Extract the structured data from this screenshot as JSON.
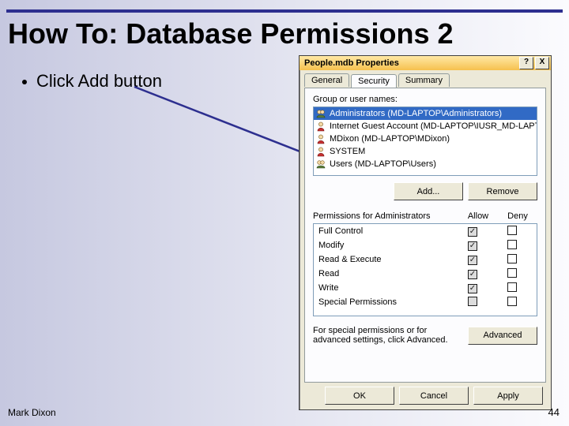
{
  "slide": {
    "title": "How To: Database Permissions 2",
    "bullet": "Click Add button",
    "footer_author": "Mark Dixon",
    "footer_page": "44"
  },
  "dialog": {
    "title": "People.mdb Properties",
    "help_btn": "?",
    "close_btn": "X",
    "tabs": {
      "general": "General",
      "security": "Security",
      "summary": "Summary",
      "active": 1
    },
    "group_label": "Group or user names:",
    "users": [
      {
        "name": "Administrators (MD-LAPTOP\\Administrators)",
        "type": "group"
      },
      {
        "name": "Internet Guest Account (MD-LAPTOP\\IUSR_MD-LAPTOP)",
        "type": "user"
      },
      {
        "name": "MDixon (MD-LAPTOP\\MDixon)",
        "type": "user"
      },
      {
        "name": "SYSTEM",
        "type": "user"
      },
      {
        "name": "Users (MD-LAPTOP\\Users)",
        "type": "group"
      }
    ],
    "selected_user_index": 0,
    "add_btn": "Add...",
    "remove_btn": "Remove",
    "perm_label": "Permissions for Administrators",
    "col_allow": "Allow",
    "col_deny": "Deny",
    "perms": [
      {
        "name": "Full Control",
        "allow": true,
        "deny": false,
        "grey": true
      },
      {
        "name": "Modify",
        "allow": true,
        "deny": false,
        "grey": true
      },
      {
        "name": "Read & Execute",
        "allow": true,
        "deny": false,
        "grey": true
      },
      {
        "name": "Read",
        "allow": true,
        "deny": false,
        "grey": true
      },
      {
        "name": "Write",
        "allow": true,
        "deny": false,
        "grey": true
      },
      {
        "name": "Special Permissions",
        "allow": false,
        "deny": false,
        "grey": true
      }
    ],
    "adv_text": "For special permissions or for advanced settings, click Advanced.",
    "adv_btn": "Advanced",
    "ok_btn": "OK",
    "cancel_btn": "Cancel",
    "apply_btn": "Apply"
  }
}
